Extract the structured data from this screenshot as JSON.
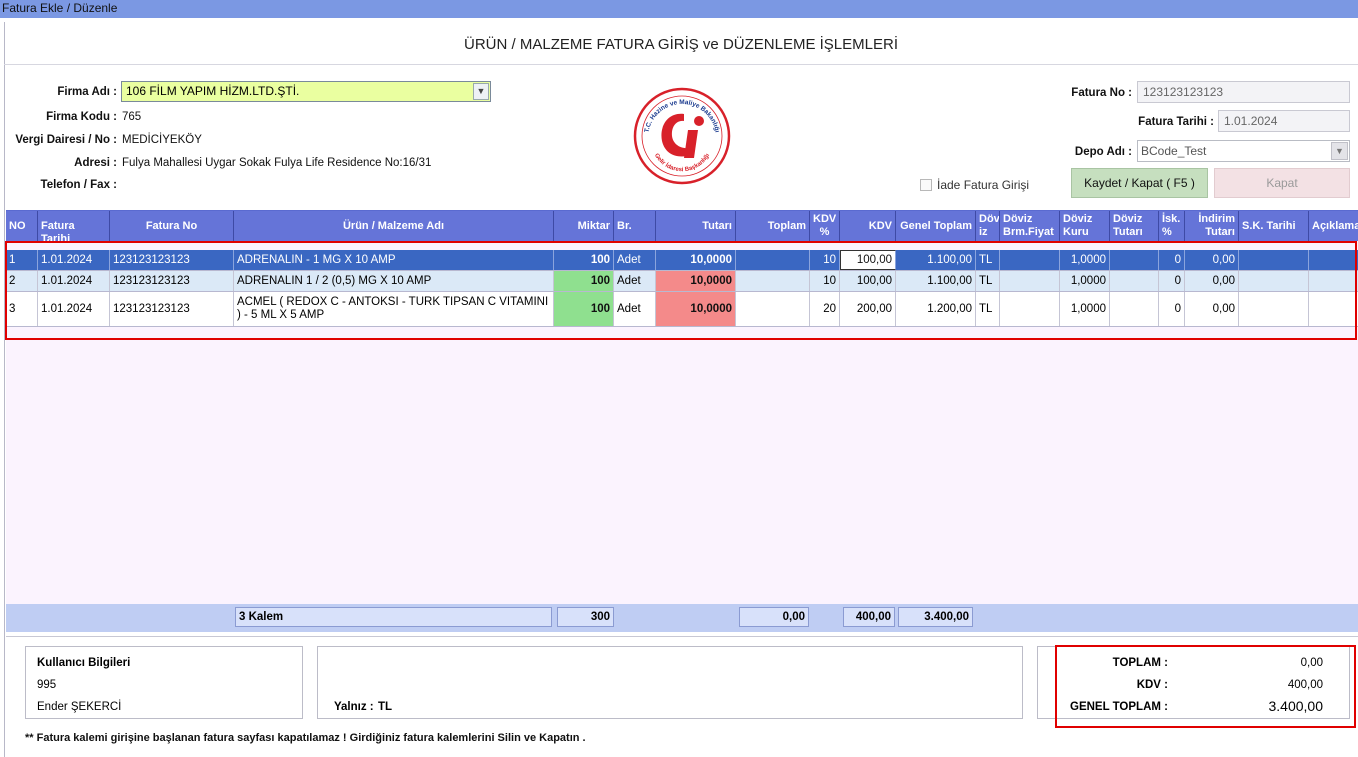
{
  "window": {
    "title": "Fatura Ekle / Düzenle"
  },
  "page": {
    "title": "ÜRÜN / MALZEME FATURA GİRİŞ ve DÜZENLEME İŞLEMLERİ"
  },
  "firm": {
    "name_label": "Firma Adı :",
    "name_value": "106 FİLM YAPIM HİZM.LTD.ŞTİ.",
    "code_label": "Firma Kodu :",
    "code_value": "765",
    "tax_label": "Vergi Dairesi / No :",
    "tax_value": "MEDİCİYEKÖY",
    "address_label": "Adresi :",
    "address_value": "Fulya Mahallesi Uygar Sokak Fulya Life Residence No:16/31",
    "phone_label": "Telefon / Fax :",
    "phone_value": ""
  },
  "logo": {
    "icon": "gib-logo-icon",
    "top_text": "T.C. Hazine ve Maliye Bakanlığı",
    "bottom_text": "Gelir İdaresi Başkanlığı"
  },
  "invoice": {
    "no_label": "Fatura No :",
    "no_value": "123123123123",
    "date_label": "Fatura Tarihi :",
    "date_value": "1.01.2024",
    "depot_label": "Depo Adı :",
    "depot_value": "BCode_Test",
    "return_label": "İade Fatura Girişi"
  },
  "buttons": {
    "save": "Kaydet / Kapat ( F5 )",
    "close": "Kapat"
  },
  "grid": {
    "columns": [
      "NO",
      "Fatura Tarihi",
      "Fatura No",
      "Ürün / Malzeme Adı",
      "Miktar",
      "Br.",
      "Tutarı",
      "Toplam",
      "KDV %",
      "KDV",
      "Genel Toplam",
      "Döv iz",
      "Döviz Brm.Fiyat",
      "Döviz Kuru",
      "Döviz Tutarı",
      "İsk. %",
      "İndirim Tutarı",
      "S.K. Tarihi",
      "Açıklama"
    ],
    "rows": [
      {
        "no": "1",
        "date": "1.01.2024",
        "invoice_no": "123123123123",
        "product": "ADRENALIN - 1 MG X 10 AMP",
        "qty": "100",
        "unit": "Adet",
        "amount": "10,0000",
        "total": "",
        "kdv_rate": "10",
        "kdv": "100,00",
        "grand_total": "1.100,00",
        "currency": "TL",
        "fx_unit_price": "",
        "fx_rate": "1,0000",
        "fx_amount": "",
        "discount_rate": "0",
        "discount_amount": "0,00",
        "expiry": "",
        "note": ""
      },
      {
        "no": "2",
        "date": "1.01.2024",
        "invoice_no": "123123123123",
        "product": "ADRENALIN 1 / 2 (0,5) MG X 10 AMP",
        "qty": "100",
        "unit": "Adet",
        "amount": "10,0000",
        "total": "",
        "kdv_rate": "10",
        "kdv": "100,00",
        "grand_total": "1.100,00",
        "currency": "TL",
        "fx_unit_price": "",
        "fx_rate": "1,0000",
        "fx_amount": "",
        "discount_rate": "0",
        "discount_amount": "0,00",
        "expiry": "",
        "note": ""
      },
      {
        "no": "3",
        "date": "1.01.2024",
        "invoice_no": "123123123123",
        "product": "ACMEL ( REDOX C - ANTOKSI -  TURK TIPSAN C VITAMINI ) - 5 ML X 5 AMP",
        "qty": "100",
        "unit": "Adet",
        "amount": "10,0000",
        "total": "",
        "kdv_rate": "20",
        "kdv": "200,00",
        "grand_total": "1.200,00",
        "currency": "TL",
        "fx_unit_price": "",
        "fx_rate": "1,0000",
        "fx_amount": "",
        "discount_rate": "0",
        "discount_amount": "0,00",
        "expiry": "",
        "note": ""
      }
    ],
    "footer": {
      "item_count": "3 Kalem",
      "qty_total": "300",
      "total": "0,00",
      "kdv_total": "400,00",
      "grand_total": "3.400,00"
    }
  },
  "user": {
    "title": "Kullanıcı Bilgileri",
    "id": "995",
    "name": "Ender ŞEKERCİ"
  },
  "amount_words": {
    "label": "Yalnız :",
    "value": "TL"
  },
  "summary": {
    "total_label": "TOPLAM :",
    "total_value": "0,00",
    "kdv_label": "KDV :",
    "kdv_value": "400,00",
    "grand_label": "GENEL TOPLAM :",
    "grand_value": "3.400,00"
  },
  "note": "** Fatura kalemi girişine başlanan fatura sayfası kapatılamaz ! Girdiğiniz fatura kalemlerini Silin ve Kapatın .",
  "colors": {
    "header_blue": "#6574d8",
    "selected_row": "#3a67c2",
    "qty_green": "#8fe08f",
    "amount_red": "#f48a8a",
    "highlight_red": "#e00000"
  }
}
